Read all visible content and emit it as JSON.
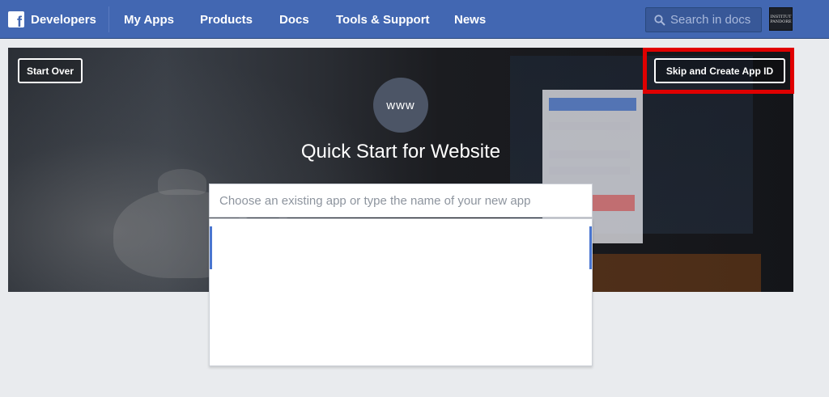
{
  "nav": {
    "brand": "Developers",
    "items": [
      "My Apps",
      "Products",
      "Docs",
      "Tools & Support",
      "News"
    ],
    "search_placeholder": "Search in docs",
    "avatar_text": "INSTITUT PANDORE"
  },
  "hero": {
    "start_over": "Start Over",
    "skip_create": "Skip and Create App ID",
    "badge": "www",
    "title": "Quick Start for Website",
    "input_placeholder": "Choose an existing app or type the name of your new app"
  },
  "colors": {
    "nav_bg": "#4267b2",
    "highlight": "#e00000",
    "accent": "#4a76d0"
  }
}
